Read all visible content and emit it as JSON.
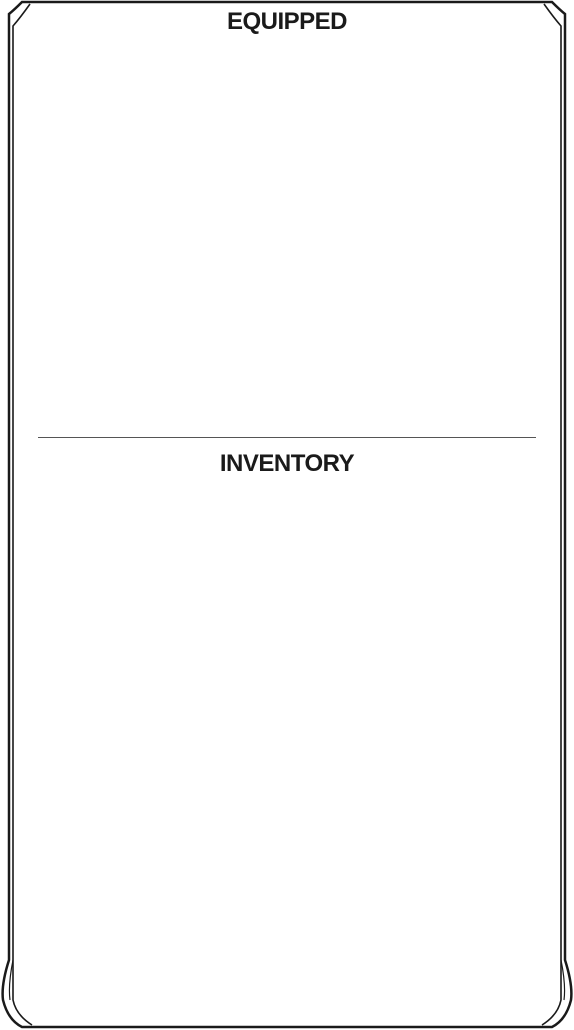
{
  "sections": {
    "equipped": {
      "title": "EQUIPPED"
    },
    "inventory": {
      "title": "INVENTORY"
    }
  },
  "colors": {
    "frame": "#1a1a1a",
    "divider": "#555555",
    "background": "#ffffff"
  }
}
